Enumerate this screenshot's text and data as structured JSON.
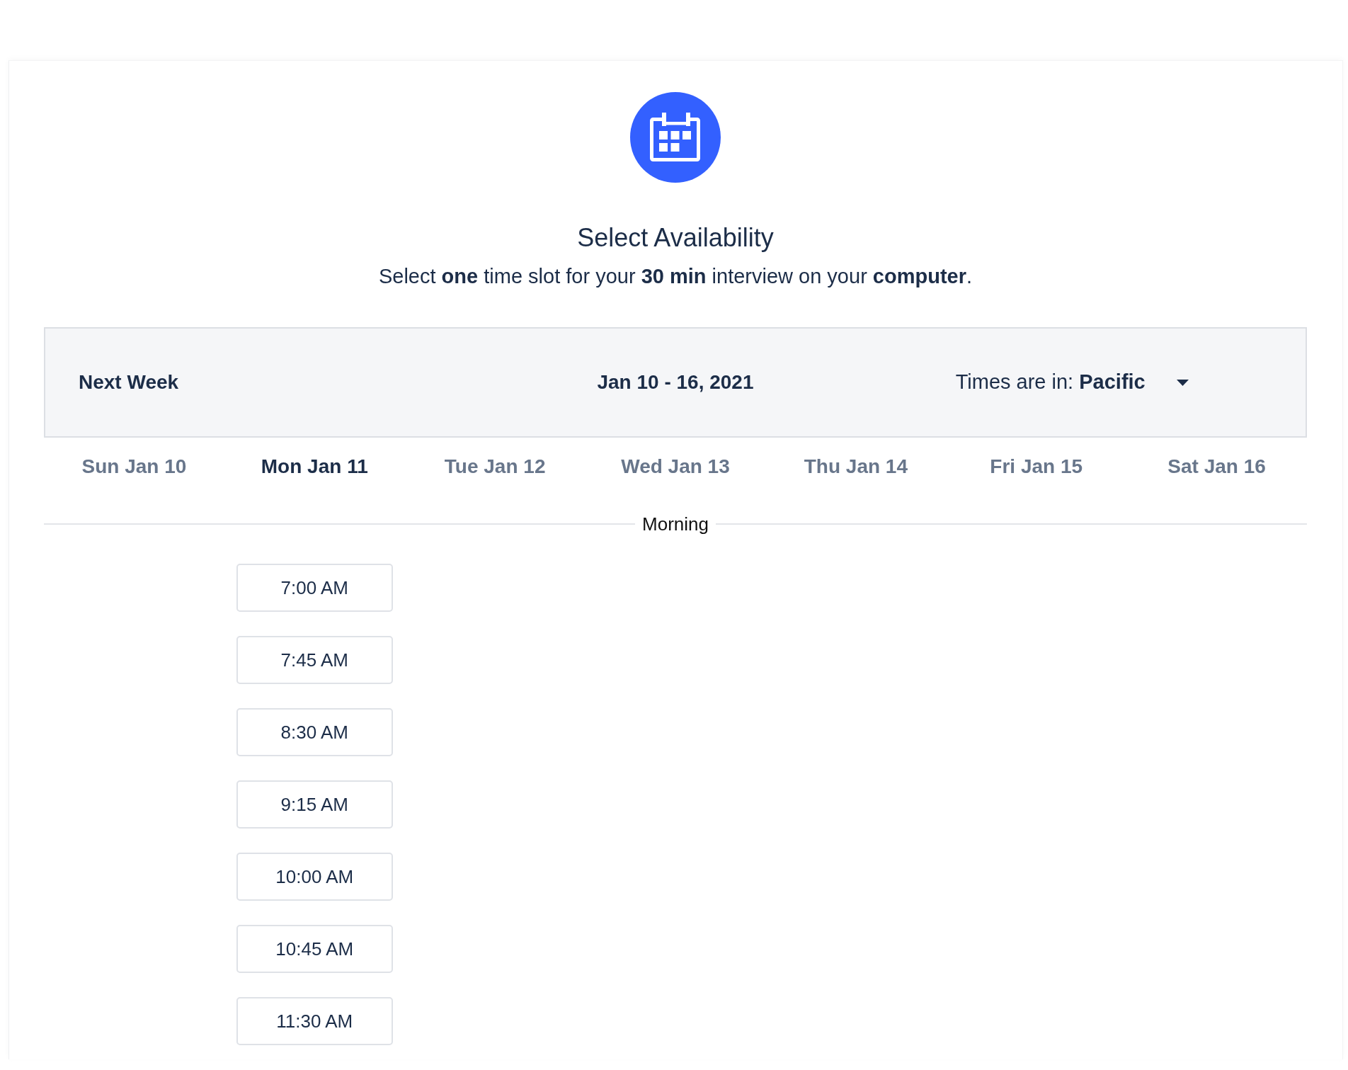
{
  "header": {
    "title": "Select Availability",
    "subtitle": "Select **one** time slot for your **30 min** interview on your **computer**."
  },
  "week_bar": {
    "nav_label": "Next Week",
    "date_range": "Jan 10 - 16, 2021",
    "timezone": "Times are in: **Pacific**"
  },
  "days": [
    {
      "label": "Sun Jan 10",
      "selected": false
    },
    {
      "label": "Mon Jan 11",
      "selected": true,
      "slots": [
        {
          "time": "7:00 AM",
          "selected": false
        },
        {
          "time": "7:45 AM",
          "selected": false
        },
        {
          "time": "8:30 AM",
          "selected": false
        },
        {
          "time": "9:15 AM",
          "selected": false
        },
        {
          "time": "10:00 AM",
          "selected": false
        },
        {
          "time": "10:45 AM",
          "selected": false
        },
        {
          "time": "11:30 AM",
          "selected": false
        }
      ]
    },
    {
      "label": "Tue Jan 12",
      "selected": false
    },
    {
      "label": "Wed Jan 13",
      "selected": false
    },
    {
      "label": "Thu Jan 14",
      "selected": false
    },
    {
      "label": "Fri Jan 15",
      "selected": false
    },
    {
      "label": "Sat Jan 16",
      "selected": false
    }
  ],
  "period": {
    "label": "Morning"
  }
}
